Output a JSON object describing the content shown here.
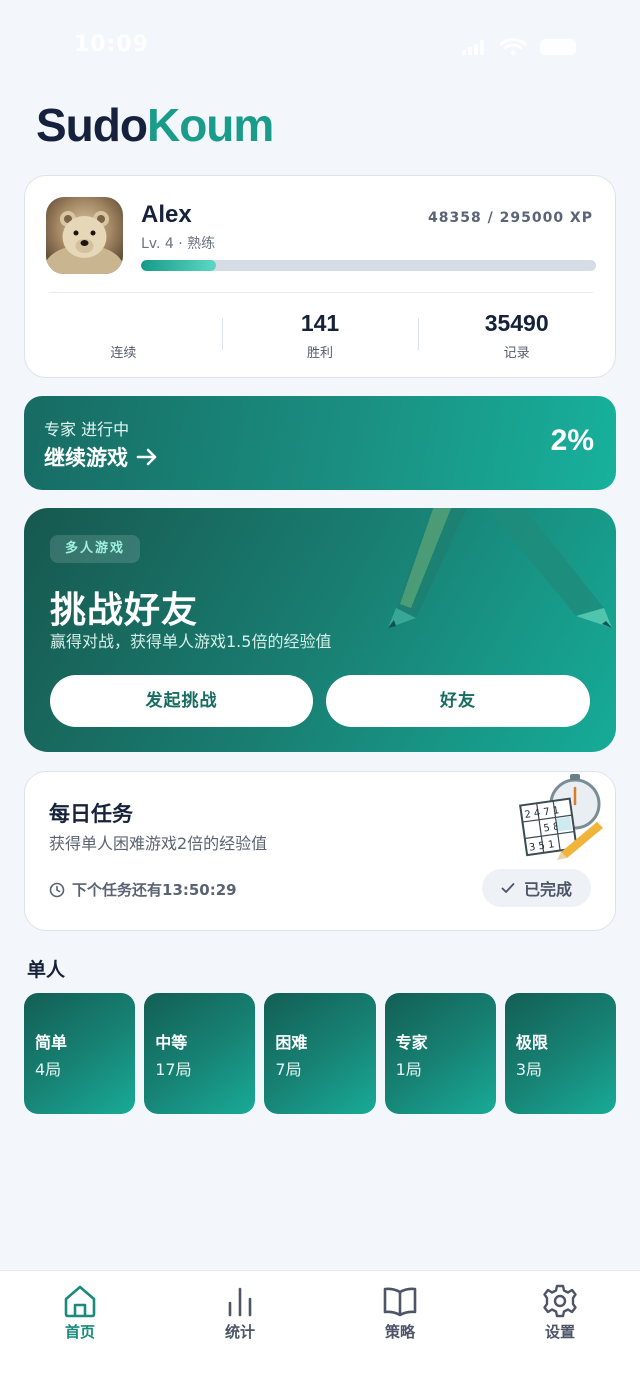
{
  "status_bar": {
    "time": "10:09"
  },
  "app": {
    "logo_part1": "Sudo",
    "logo_part2": "Koum"
  },
  "profile": {
    "name": "Alex",
    "level": "Lv. 4 · 熟练",
    "xp_text": "48358 / 295000 XP",
    "xp_progress_percent": 16.4,
    "stats": [
      {
        "value": "",
        "label": "连续"
      },
      {
        "value": "141",
        "label": "胜利"
      },
      {
        "value": "35490",
        "label": "记录"
      }
    ]
  },
  "continue_game": {
    "mode": "专家 进行中",
    "label": "继续游戏",
    "percent": "2%"
  },
  "challenge": {
    "badge": "多人游戏",
    "title": "挑战好友",
    "subtitle": "赢得对战，获得单人游戏1.5倍的经验值",
    "start_button": "发起挑战",
    "friends_button": "好友"
  },
  "daily_task": {
    "title": "每日任务",
    "subtitle": "获得单人困难游戏2倍的经验值",
    "timer": "下个任务还有13:50:29",
    "status": "已完成"
  },
  "single_player": {
    "title": "单人",
    "levels": [
      {
        "name": "简单",
        "count": "4局"
      },
      {
        "name": "中等",
        "count": "17局"
      },
      {
        "name": "困难",
        "count": "7局"
      },
      {
        "name": "专家",
        "count": "1局"
      },
      {
        "name": "极限",
        "count": "3局"
      }
    ]
  },
  "tabbar": {
    "tabs": [
      {
        "label": "首页",
        "icon": "home-icon",
        "active": true
      },
      {
        "label": "统计",
        "icon": "bar-chart-icon",
        "active": false
      },
      {
        "label": "策略",
        "icon": "book-icon",
        "active": false
      },
      {
        "label": "设置",
        "icon": "gear-icon",
        "active": false
      }
    ]
  },
  "colors": {
    "accent": "#1a9c8b",
    "brand_dark": "#15213d",
    "background": "#f3f6fa"
  }
}
